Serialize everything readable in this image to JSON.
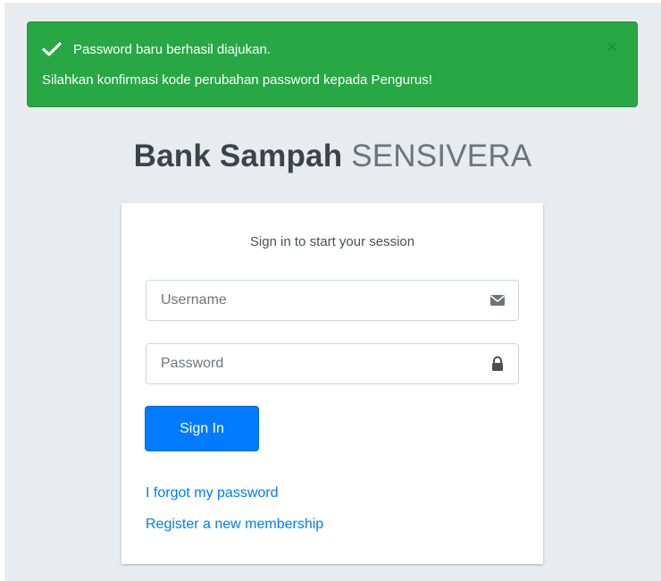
{
  "alert": {
    "line1": "Password baru berhasil diajukan.",
    "line2": "Silahkan konfirmasi kode perubahan password kepada Pengurus!",
    "close": "×",
    "color": "#28a745"
  },
  "brand": {
    "bold": "Bank Sampah",
    "light": "SENSIVERA"
  },
  "login": {
    "message": "Sign in to start your session",
    "username_placeholder": "Username",
    "password_placeholder": "Password",
    "signin_label": "Sign In",
    "forgot_label": "I forgot my password",
    "register_label": "Register a new membership",
    "accent": "#007bff"
  },
  "icons": {
    "alert": "check-icon",
    "username": "envelope-icon",
    "password": "lock-icon",
    "close": "close-icon"
  }
}
